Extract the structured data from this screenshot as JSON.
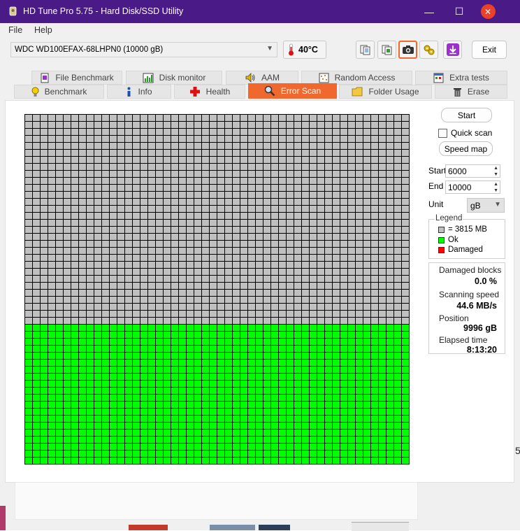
{
  "window": {
    "title": "HD Tune Pro 5.75 - Hard Disk/SSD Utility",
    "controls": {
      "minimize": "—",
      "maximize": "☐",
      "close": "✕"
    }
  },
  "menu": {
    "file": "File",
    "help": "Help"
  },
  "toolbar": {
    "drive": "WDC WD100EFAX-68LHPN0 (10000 gB)",
    "temperature": "40°C",
    "exit_label": "Exit"
  },
  "tabs": {
    "top": [
      "File Benchmark",
      "Disk monitor",
      "AAM",
      "Random Access",
      "Extra tests"
    ],
    "bottom": [
      "Benchmark",
      "Info",
      "Health",
      "Error Scan",
      "Folder Usage",
      "Erase"
    ],
    "active": "Error Scan"
  },
  "scan": {
    "rows": 50,
    "cols": 50,
    "ok_rows_from_bottom": 20,
    "ok_fraction": 0.4
  },
  "controls": {
    "start_button": "Start",
    "quick_scan_label": "Quick scan",
    "quick_scan_checked": false,
    "speed_map_button": "Speed map",
    "start_label": "Start",
    "start_value": "6000",
    "end_label": "End",
    "end_value": "10000",
    "unit_label": "Unit",
    "unit_value": "gB"
  },
  "legend": {
    "title": "Legend",
    "block_size": "= 3815 MB",
    "ok": "Ok",
    "damaged": "Damaged"
  },
  "stats": {
    "damaged_blocks_label": "Damaged blocks",
    "damaged_blocks_value": "0.0 %",
    "scanning_speed_label": "Scanning speed",
    "scanning_speed_value": "44.6 MB/s",
    "position_label": "Position",
    "position_value": "9996 gB",
    "elapsed_label": "Elapsed time",
    "elapsed_value": "8:13:20"
  },
  "colors": {
    "titlebar": "#4a1b86",
    "active_tab": "#f0682d",
    "block_unscanned": "#c0c0c0",
    "block_ok": "#00ff00",
    "block_damaged": "#ff0000"
  },
  "background_text": "5"
}
